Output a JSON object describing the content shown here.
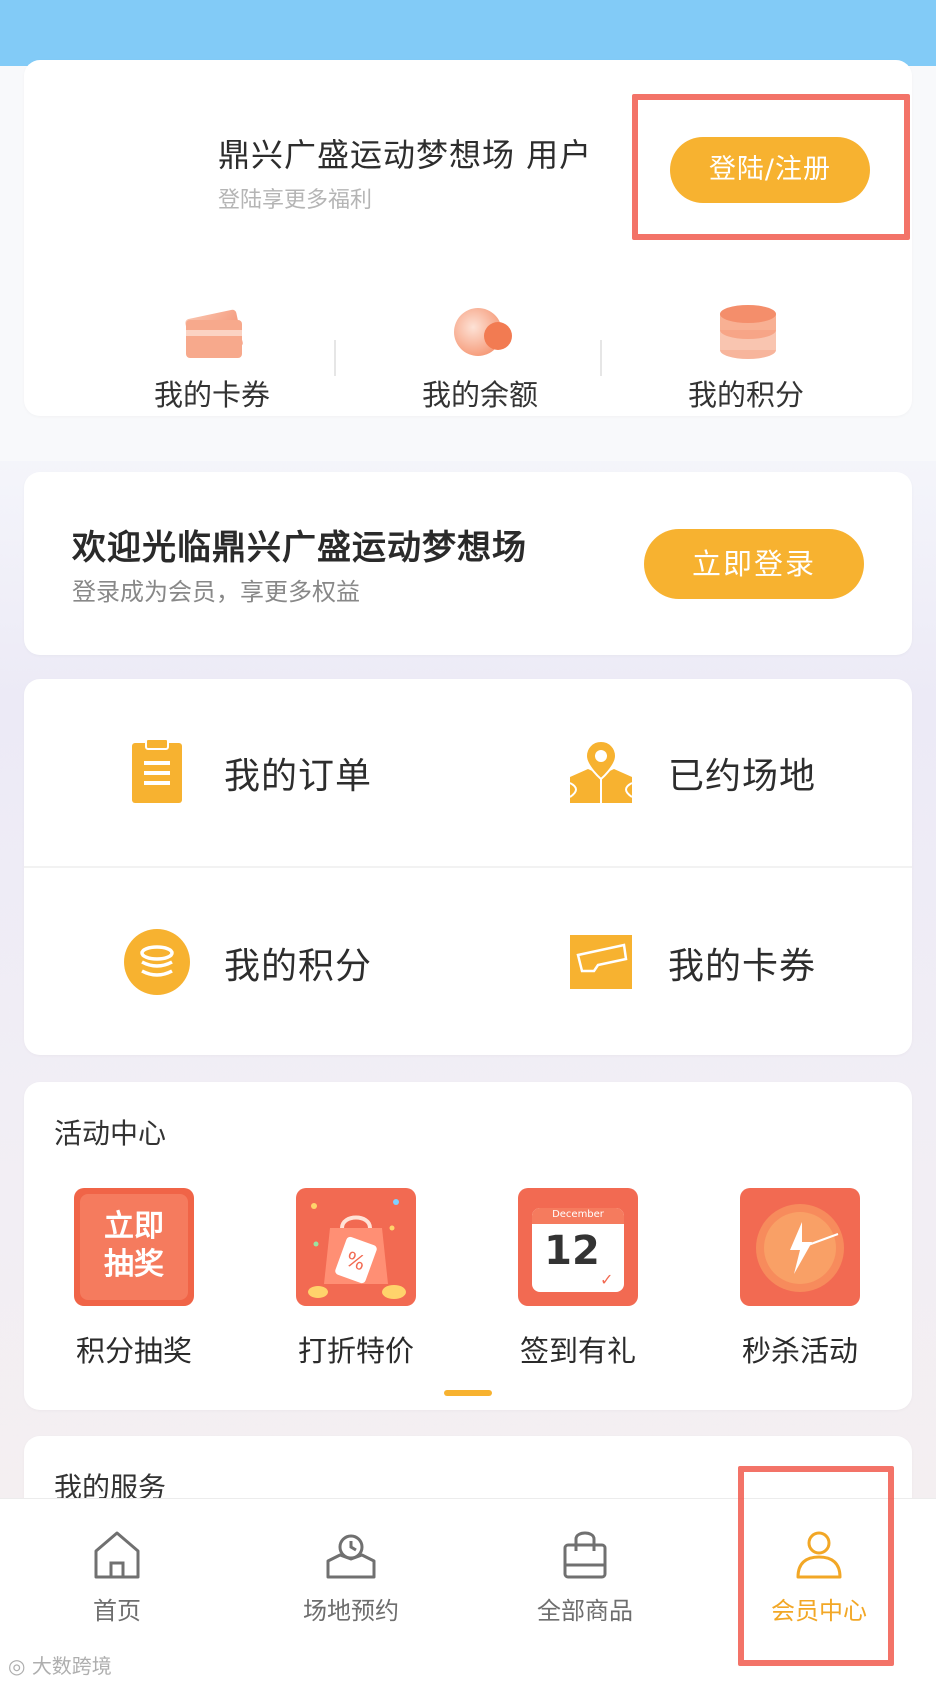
{
  "user_card": {
    "name": "鼎兴广盛运动梦想场 用户",
    "subtitle": "登陆享更多福利",
    "login_button": "登陆/注册",
    "stats": [
      {
        "label": "我的卡券",
        "icon": "card-icon"
      },
      {
        "label": "我的余额",
        "icon": "wallet-icon"
      },
      {
        "label": "我的积分",
        "icon": "coins-icon"
      }
    ]
  },
  "welcome": {
    "title": "欢迎光临鼎兴广盛运动梦想场",
    "subtitle": "登录成为会员，享更多权益",
    "button": "立即登录"
  },
  "quick": [
    {
      "label": "我的订单",
      "icon": "order-icon"
    },
    {
      "label": "已约场地",
      "icon": "venue-map-icon"
    },
    {
      "label": "我的积分",
      "icon": "points-icon"
    },
    {
      "label": "我的卡券",
      "icon": "coupon-icon"
    }
  ],
  "activity": {
    "title": "活动中心",
    "items": [
      {
        "label": "积分抽奖",
        "icon_text": "立即\n抽奖",
        "icon": "lottery-icon"
      },
      {
        "label": "打折特价",
        "icon": "discount-bag-icon"
      },
      {
        "label": "签到有礼",
        "icon": "calendar-icon",
        "calendar_month": "December",
        "calendar_day": "12"
      },
      {
        "label": "秒杀活动",
        "icon": "flash-clock-icon"
      }
    ]
  },
  "services": {
    "title": "我的服务"
  },
  "tabbar": [
    {
      "label": "首页",
      "icon": "home-icon"
    },
    {
      "label": "场地预约",
      "icon": "venue-booking-icon"
    },
    {
      "label": "全部商品",
      "icon": "shopping-bag-icon"
    },
    {
      "label": "会员中心",
      "icon": "member-icon",
      "active": true
    }
  ],
  "watermark": "大数跨境",
  "colors": {
    "accent": "#f7b230",
    "highlight": "#f15a4e",
    "top_bar": "#82cbf7"
  }
}
